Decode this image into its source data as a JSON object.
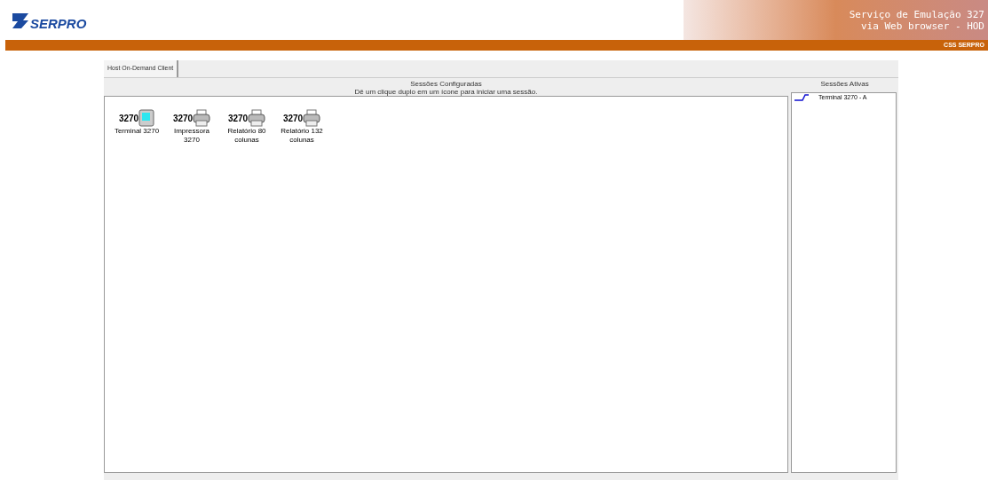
{
  "header": {
    "logo": "SERPRO",
    "title_lines": [
      "Serviço de Emulação 327",
      "via Web browser - HOD"
    ],
    "bar_text": "CSS SERPRO"
  },
  "tabs": [
    {
      "label": "Host On-Demand Client",
      "selected": true
    }
  ],
  "configured": {
    "title": "Sessões Configuradas",
    "hint": "Dê um clique duplo em um ícone para iniciar uma sessão.",
    "sessions": [
      {
        "badge": "3270",
        "kind": "terminal",
        "label_lines": [
          "Terminal 3270"
        ]
      },
      {
        "badge": "3270",
        "kind": "printer",
        "label_lines": [
          "Impressora",
          "3270"
        ]
      },
      {
        "badge": "3270",
        "kind": "printer",
        "label_lines": [
          "Relatório 80",
          "colunas"
        ]
      },
      {
        "badge": "3270",
        "kind": "printer",
        "label_lines": [
          "Relatório 132",
          "colunas"
        ]
      }
    ]
  },
  "active": {
    "title": "Sessões Ativas",
    "sessions": [
      {
        "label": "Terminal 3270 - A"
      }
    ]
  }
}
